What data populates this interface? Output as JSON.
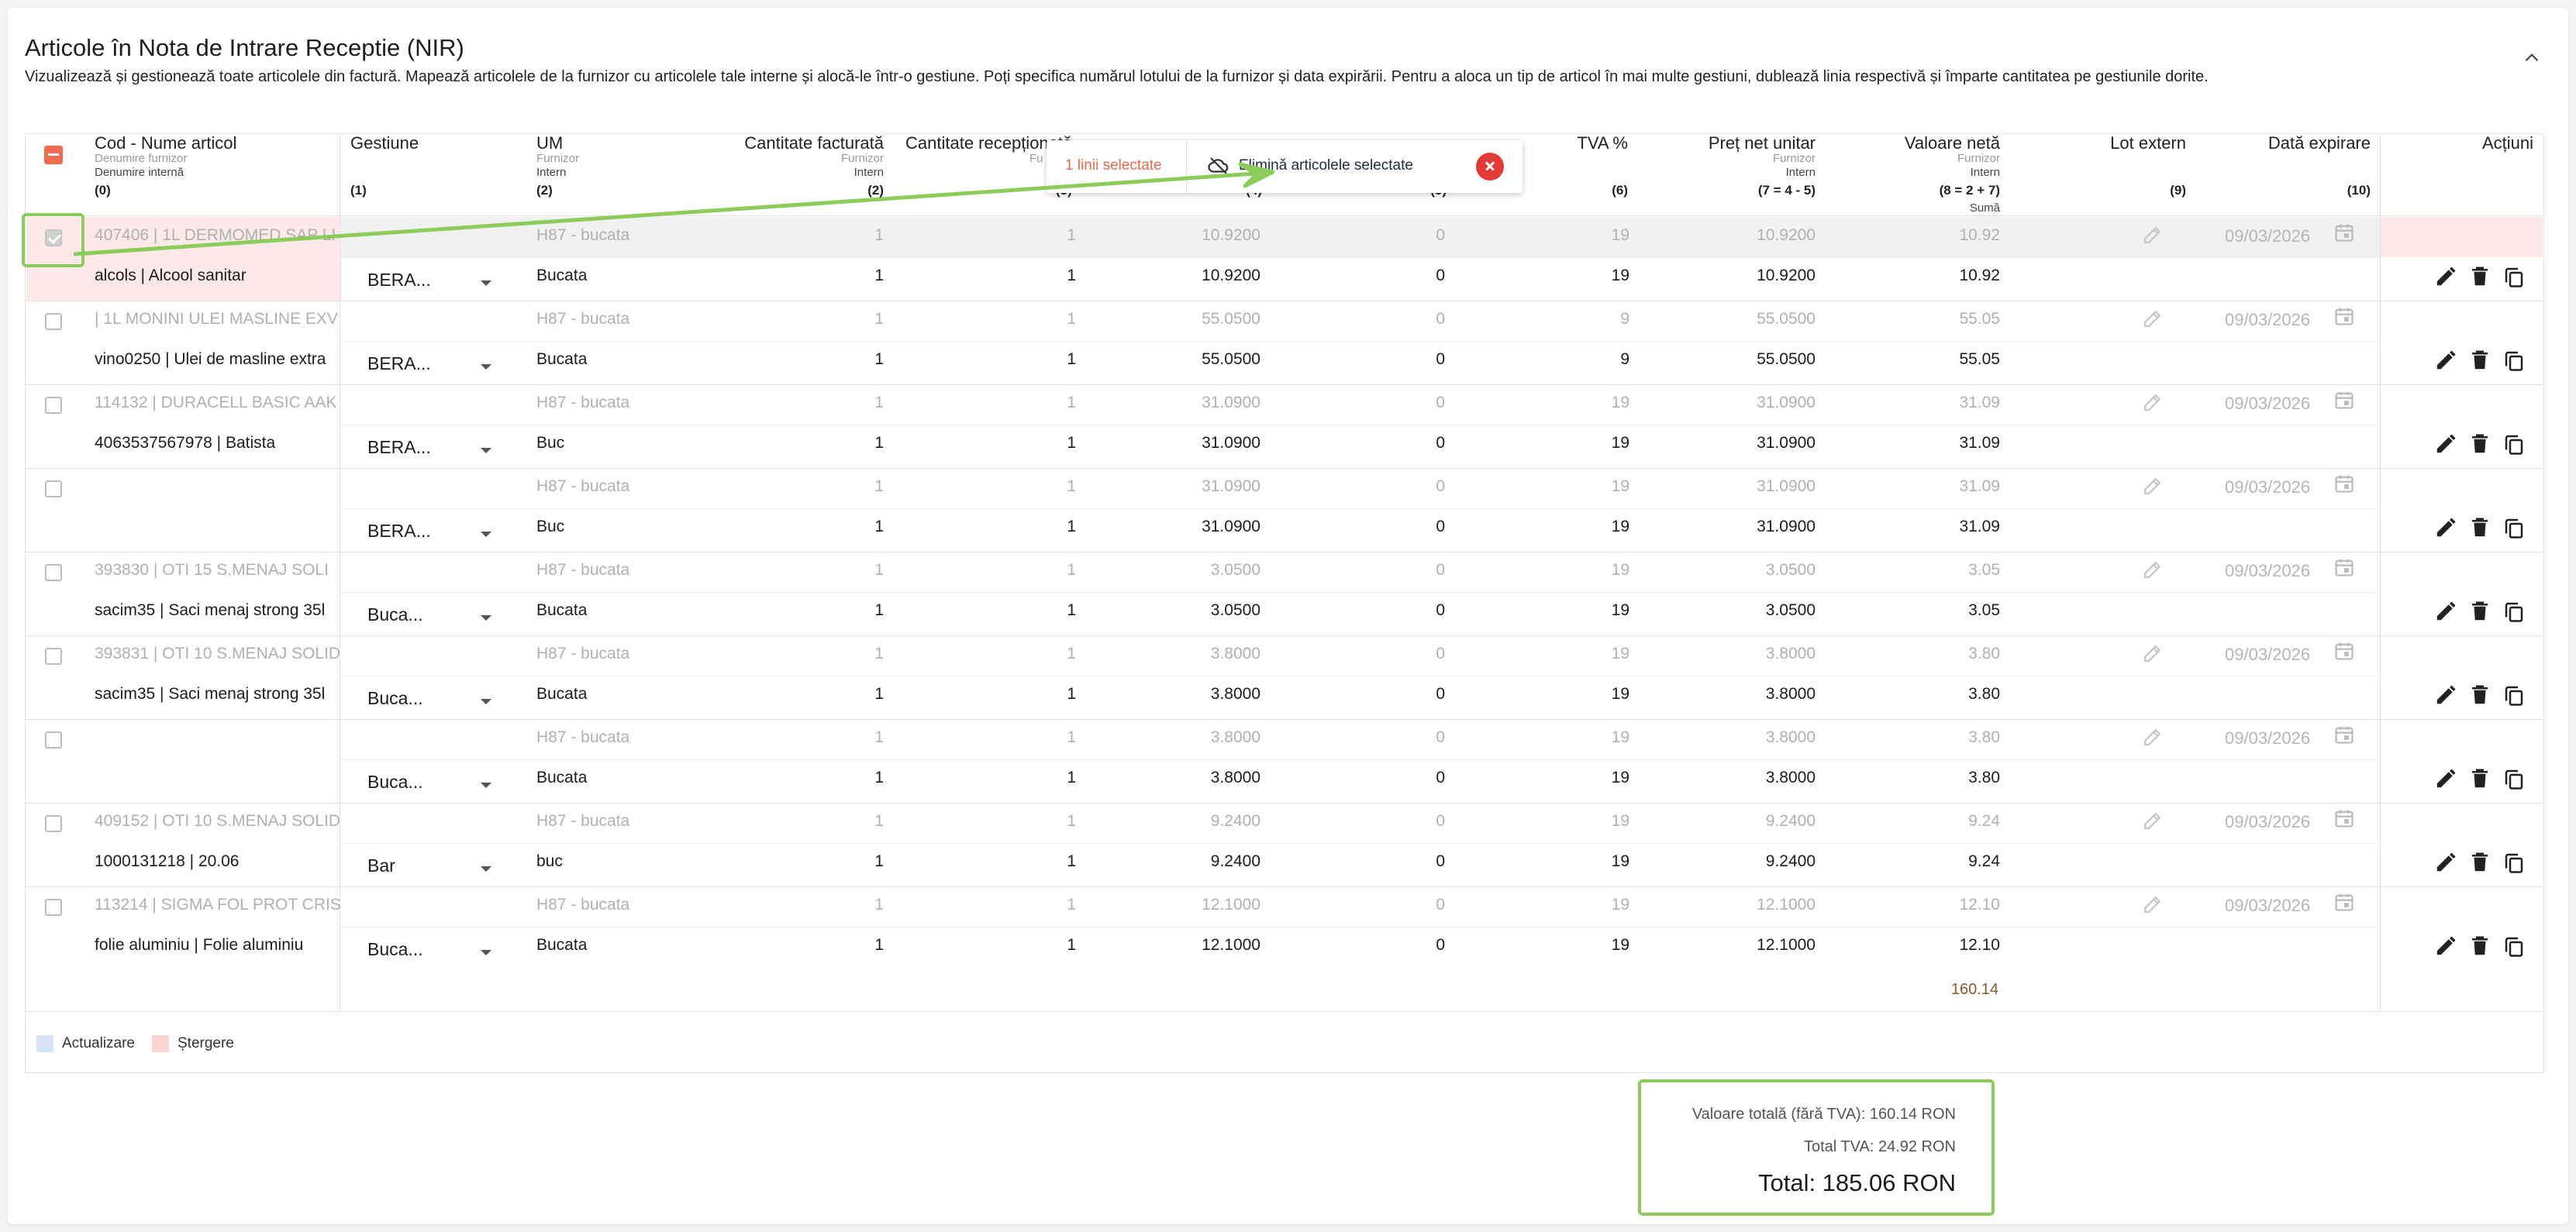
{
  "header": {
    "title": "Articole în Nota de Intrare Receptie (NIR)",
    "description": "Vizualizează și gestionează toate articolele din factură. Mapează articolele de la furnizor cu articolele tale interne și alocă-le într-o gestiune. Poți specifica numărul lotului de la furnizor și data expirării. Pentru a aloca un tip de articol în mai multe gestiuni, dublează linia respectivă și împarte cantitatea pe gestiunile dorite."
  },
  "columns": {
    "cod": {
      "title": "Cod - Nume articol",
      "sub1": "Denumire furnizor",
      "sub2": "Denumire internă",
      "num": "(0)"
    },
    "gestiune": {
      "title": "Gestiune",
      "num": "(1)"
    },
    "um": {
      "title": "UM",
      "sub1": "Furnizor",
      "sub2": "Intern",
      "num": "(2)"
    },
    "cant_fact": {
      "title": "Cantitate facturată",
      "sub1": "Furnizor",
      "sub2": "Intern",
      "num": "(2)"
    },
    "cant_rec": {
      "title": "Cantitate recepționată",
      "sub1": "Fu",
      "num": "(3)"
    },
    "pret_lista": {
      "num": "(4)"
    },
    "reducere": {
      "num": "(5)"
    },
    "tva": {
      "title": "TVA %",
      "num": "(6)"
    },
    "pret_net": {
      "title": "Preț net unitar",
      "sub1": "Furnizor",
      "sub2": "Intern",
      "num": "(7 = 4 - 5)"
    },
    "valoare_neta": {
      "title": "Valoare netă",
      "sub1": "Furnizor",
      "sub2": "Intern",
      "num": "(8 = 2 + 7)",
      "sub3": "Sumă"
    },
    "lot": {
      "title": "Lot extern",
      "num": "(9)"
    },
    "data_exp": {
      "title": "Dată expirare",
      "num": "(10)"
    },
    "actiuni": {
      "title": "Acțiuni"
    }
  },
  "selection_bar": {
    "count": "1 linii selectate",
    "delete_label": "Elimină articolele selectate"
  },
  "rows": [
    {
      "sup_name": "407406 | 1L DERMOMED SAP LI",
      "int_name": "alcols | Alcool sanitar",
      "gest": "BERA...",
      "um_sup": "H87 - bucata",
      "um_int": "Bucata",
      "qf_sup": "1",
      "qf_int": "1",
      "qr_sup": "1",
      "qr_int": "1",
      "price_sup": "10.9200",
      "price_int": "10.9200",
      "disc_sup": "0",
      "disc_int": "0",
      "tva_sup": "19",
      "tva_int": "19",
      "net_sup": "10.9200",
      "net_int": "10.9200",
      "val_sup": "10.92",
      "val_int": "10.92",
      "date": "09/03/2026",
      "checked": true
    },
    {
      "sup_name": "| 1L MONINI ULEI MASLINE EXV",
      "int_name": "vino0250 | Ulei de masline extra",
      "gest": "BERA...",
      "um_sup": "H87 - bucata",
      "um_int": "Bucata",
      "qf_sup": "1",
      "qf_int": "1",
      "qr_sup": "1",
      "qr_int": "1",
      "price_sup": "55.0500",
      "price_int": "55.0500",
      "disc_sup": "0",
      "disc_int": "0",
      "tva_sup": "9",
      "tva_int": "9",
      "net_sup": "55.0500",
      "net_int": "55.0500",
      "val_sup": "55.05",
      "val_int": "55.05",
      "date": "09/03/2026"
    },
    {
      "sup_name": "114132 | DURACELL BASIC AAK",
      "int_name": "4063537567978 | Batista",
      "gest": "BERA...",
      "um_sup": "H87 - bucata",
      "um_int": "Buc",
      "qf_sup": "1",
      "qf_int": "1",
      "qr_sup": "1",
      "qr_int": "1",
      "price_sup": "31.0900",
      "price_int": "31.0900",
      "disc_sup": "0",
      "disc_int": "0",
      "tva_sup": "19",
      "tva_int": "19",
      "net_sup": "31.0900",
      "net_int": "31.0900",
      "val_sup": "31.09",
      "val_int": "31.09",
      "date": "09/03/2026"
    },
    {
      "sup_name": "",
      "int_name": "",
      "gest": "BERA...",
      "um_sup": "H87 - bucata",
      "um_int": "Buc",
      "qf_sup": "1",
      "qf_int": "1",
      "qr_sup": "1",
      "qr_int": "1",
      "price_sup": "31.0900",
      "price_int": "31.0900",
      "disc_sup": "0",
      "disc_int": "0",
      "tva_sup": "19",
      "tva_int": "19",
      "net_sup": "31.0900",
      "net_int": "31.0900",
      "val_sup": "31.09",
      "val_int": "31.09",
      "date": "09/03/2026"
    },
    {
      "sup_name": "393830 | OTI 15 S.MENAJ SOLI",
      "int_name": "sacim35 | Saci menaj strong 35l",
      "gest": "Buca...",
      "um_sup": "H87 - bucata",
      "um_int": "Bucata",
      "qf_sup": "1",
      "qf_int": "1",
      "qr_sup": "1",
      "qr_int": "1",
      "price_sup": "3.0500",
      "price_int": "3.0500",
      "disc_sup": "0",
      "disc_int": "0",
      "tva_sup": "19",
      "tva_int": "19",
      "net_sup": "3.0500",
      "net_int": "3.0500",
      "val_sup": "3.05",
      "val_int": "3.05",
      "date": "09/03/2026"
    },
    {
      "sup_name": "393831 | OTI 10 S.MENAJ SOLID",
      "int_name": "sacim35 | Saci menaj strong 35l",
      "gest": "Buca...",
      "um_sup": "H87 - bucata",
      "um_int": "Bucata",
      "qf_sup": "1",
      "qf_int": "1",
      "qr_sup": "1",
      "qr_int": "1",
      "price_sup": "3.8000",
      "price_int": "3.8000",
      "disc_sup": "0",
      "disc_int": "0",
      "tva_sup": "19",
      "tva_int": "19",
      "net_sup": "3.8000",
      "net_int": "3.8000",
      "val_sup": "3.80",
      "val_int": "3.80",
      "date": "09/03/2026"
    },
    {
      "sup_name": "",
      "int_name": "",
      "gest": "Buca...",
      "um_sup": "H87 - bucata",
      "um_int": "Bucata",
      "qf_sup": "1",
      "qf_int": "1",
      "qr_sup": "1",
      "qr_int": "1",
      "price_sup": "3.8000",
      "price_int": "3.8000",
      "disc_sup": "0",
      "disc_int": "0",
      "tva_sup": "19",
      "tva_int": "19",
      "net_sup": "3.8000",
      "net_int": "3.8000",
      "val_sup": "3.80",
      "val_int": "3.80",
      "date": "09/03/2026"
    },
    {
      "sup_name": "409152 | OTI 10 S.MENAJ SOLID",
      "int_name": "1000131218 | 20.06",
      "gest": "Bar",
      "um_sup": "H87 - bucata",
      "um_int": "buc",
      "qf_sup": "1",
      "qf_int": "1",
      "qr_sup": "1",
      "qr_int": "1",
      "price_sup": "9.2400",
      "price_int": "9.2400",
      "disc_sup": "0",
      "disc_int": "0",
      "tva_sup": "19",
      "tva_int": "19",
      "net_sup": "9.2400",
      "net_int": "9.2400",
      "val_sup": "9.24",
      "val_int": "9.24",
      "date": "09/03/2026"
    },
    {
      "sup_name": "113214 | SIGMA FOL PROT CRIS",
      "int_name": "folie aluminiu | Folie aluminiu",
      "gest": "Buca...",
      "um_sup": "H87 - bucata",
      "um_int": "Bucata",
      "qf_sup": "1",
      "qf_int": "1",
      "qr_sup": "1",
      "qr_int": "1",
      "price_sup": "12.1000",
      "price_int": "12.1000",
      "disc_sup": "0",
      "disc_int": "0",
      "tva_sup": "19",
      "tva_int": "19",
      "net_sup": "12.1000",
      "net_int": "12.1000",
      "val_sup": "12.10",
      "val_int": "12.10",
      "date": "09/03/2026"
    }
  ],
  "footer_sum": "160.14",
  "legend": {
    "update": "Actualizare",
    "delete": "Ștergere",
    "update_color": "#d6e4fb",
    "delete_color": "#fcd4d4"
  },
  "totals": {
    "without_vat": "Valoare totală (fără TVA): 160.14 RON",
    "vat": "Total TVA: 24.92 RON",
    "total": "Total: 185.06 RON"
  },
  "colors": {
    "accent": "#f26b4f",
    "highlight": "#8ccc5a",
    "danger": "#e53935"
  }
}
